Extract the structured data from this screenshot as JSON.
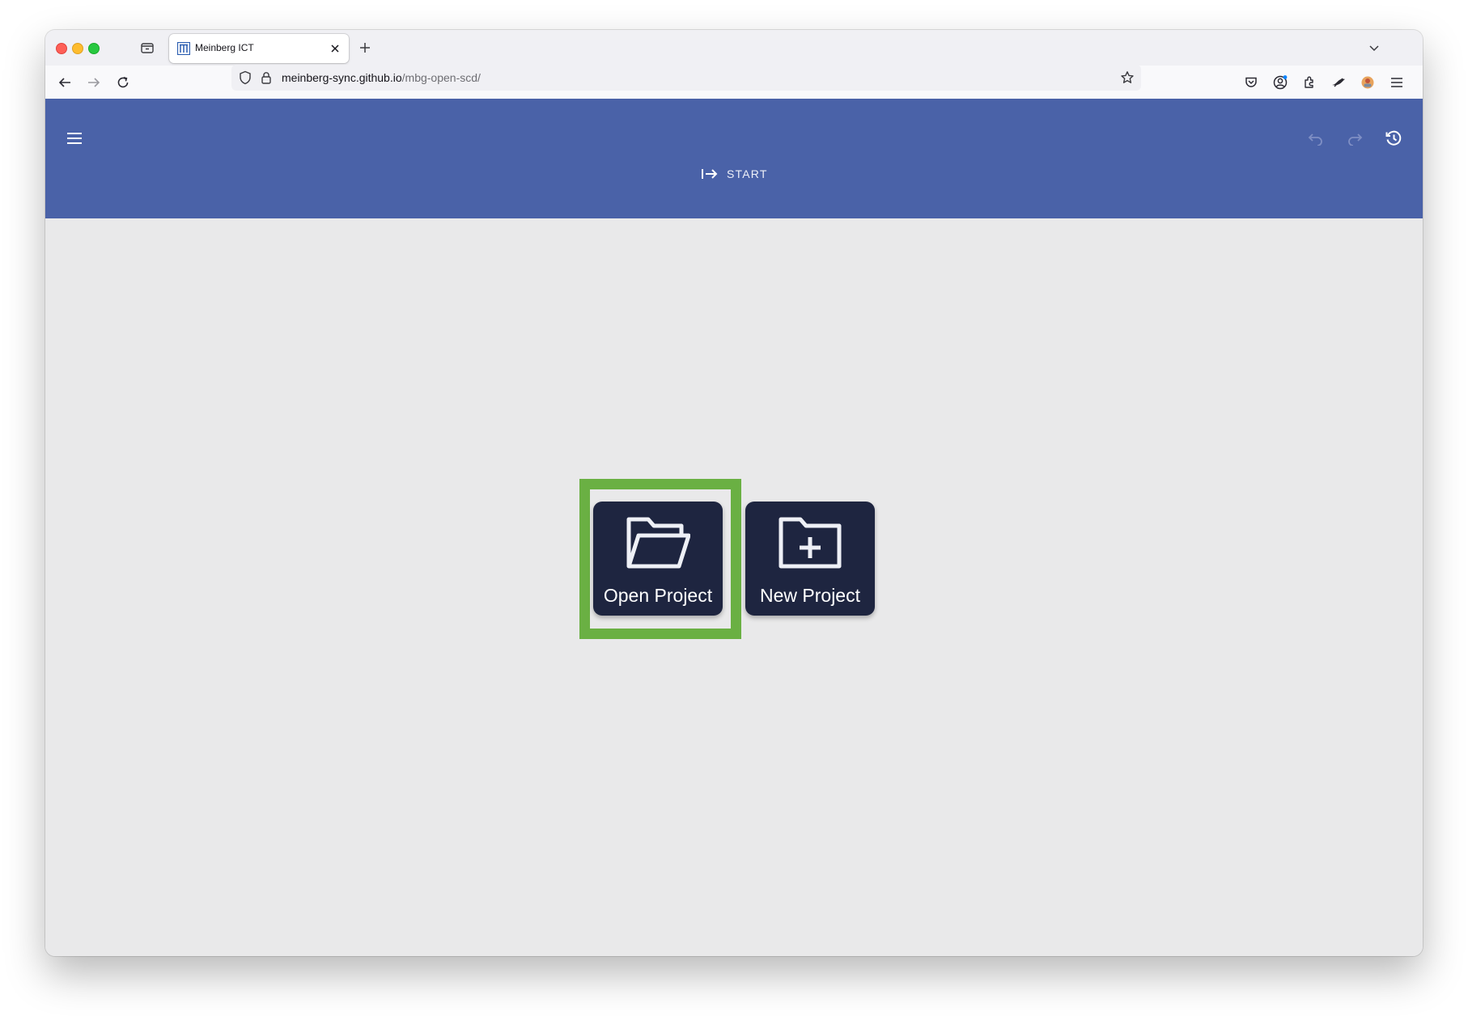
{
  "browser": {
    "tab": {
      "title": "Meinberg ICT"
    },
    "url": {
      "host": "meinberg-sync.github.io",
      "path": "/mbg-open-scd/"
    }
  },
  "app": {
    "header": {
      "start_label": "START"
    },
    "actions": {
      "open_project": "Open Project",
      "new_project": "New Project"
    }
  },
  "colors": {
    "header": "#4a62a8",
    "card": "#1e2540",
    "content_bg": "#e9e9ea",
    "highlight": "#6ab043"
  }
}
